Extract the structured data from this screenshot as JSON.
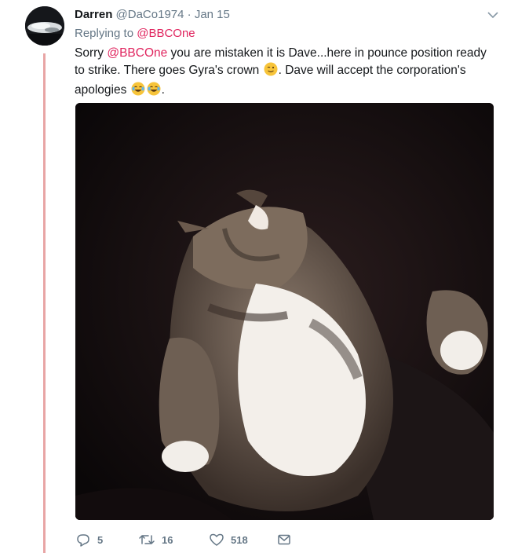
{
  "tweet": {
    "author_name": "Darren",
    "author_handle": "@DaCo1974",
    "separator": "·",
    "date": "Jan 15",
    "replying_prefix": "Replying to",
    "replying_handle": "@BBCOne",
    "text": {
      "part1": "Sorry ",
      "mention": "@BBCOne",
      "part2": " you are mistaken it is Dave...here in pounce position ready to strike. There goes Gyra's crown ",
      "part3": ". Dave will accept the corporation's apologies ",
      "part4": "."
    },
    "emojis": [
      "winking-face-emoji",
      "tears-of-joy-emoji",
      "tears-of-joy-emoji"
    ],
    "image": {
      "description_icon": "cat-photo"
    }
  },
  "actions": {
    "reply_count": "5",
    "retweet_count": "16",
    "like_count": "518"
  },
  "colors": {
    "mention": "#e0245e",
    "muted": "#657786",
    "thread_line": "#e8a5a5"
  }
}
